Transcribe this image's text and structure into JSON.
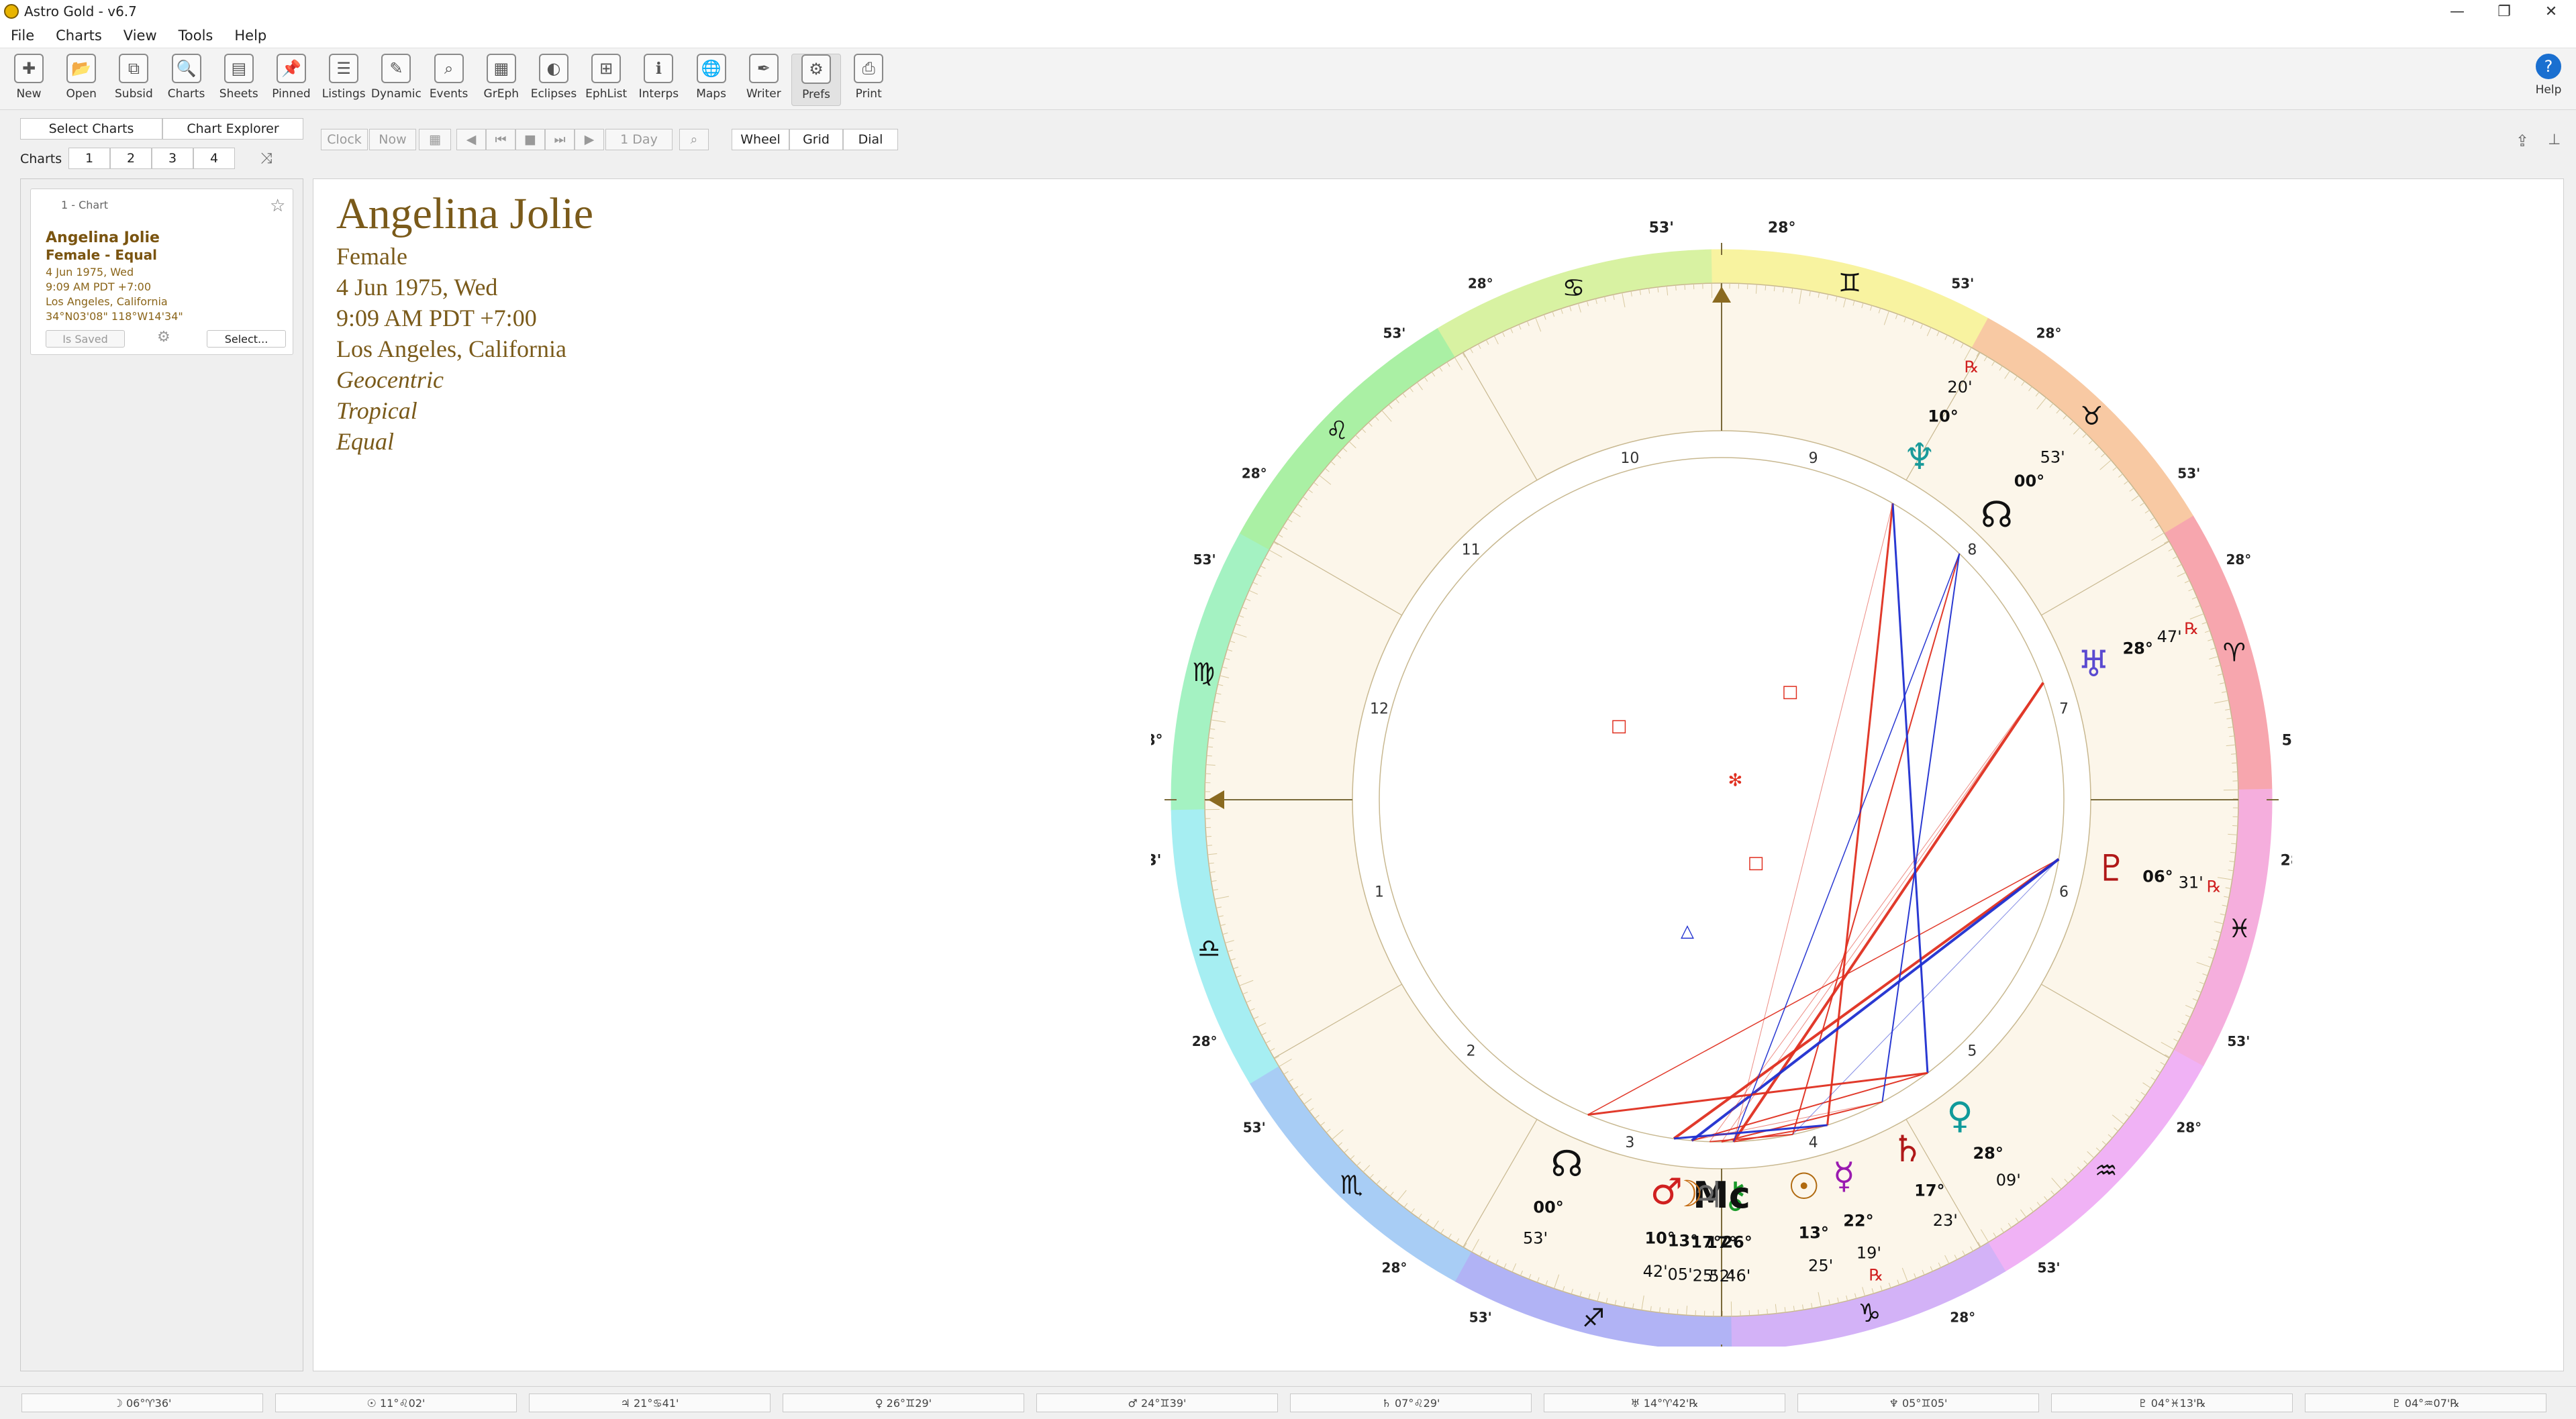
{
  "window": {
    "title": "Astro Gold - v6.7"
  },
  "menu": [
    "File",
    "Charts",
    "View",
    "Tools",
    "Help"
  ],
  "toolbar": [
    {
      "label": "New",
      "icon": "new-chart-icon"
    },
    {
      "label": "Open",
      "icon": "open-icon"
    },
    {
      "label": "Subsid",
      "icon": "subsid-icon"
    },
    {
      "label": "Charts",
      "icon": "charts-icon"
    },
    {
      "label": "Sheets",
      "icon": "sheets-icon"
    },
    {
      "label": "Pinned",
      "icon": "pin-icon"
    },
    {
      "label": "Listings",
      "icon": "listings-icon"
    },
    {
      "label": "Dynamic",
      "icon": "dynamic-icon"
    },
    {
      "label": "Events",
      "icon": "events-icon"
    },
    {
      "label": "GrEph",
      "icon": "graphic-ephemeris-icon"
    },
    {
      "label": "Eclipses",
      "icon": "eclipses-icon"
    },
    {
      "label": "EphList",
      "icon": "ephemeris-list-icon"
    },
    {
      "label": "Interps",
      "icon": "interpretations-icon"
    },
    {
      "label": "Maps",
      "icon": "globe-icon"
    },
    {
      "label": "Writer",
      "icon": "quill-icon"
    },
    {
      "label": "Prefs",
      "icon": "gear-icon"
    },
    {
      "label": "Print",
      "icon": "printer-icon"
    }
  ],
  "help_label": "Help",
  "left_tabs": [
    "Select Charts",
    "Chart Explorer"
  ],
  "charts_label": "Charts",
  "chart_slots": [
    "1",
    "2",
    "3",
    "4"
  ],
  "time_controls": {
    "clock": "Clock",
    "now": "Now",
    "step": "1 Day"
  },
  "view_tabs": [
    "Wheel",
    "Grid",
    "Dial"
  ],
  "chart_card": {
    "header": "1 - Chart",
    "name": "Angelina Jolie",
    "subtitle": "Female - Equal",
    "date": "4 Jun 1975, Wed",
    "time": "9:09 AM PDT +7:00",
    "place": "Los Angeles, California",
    "coords": "34°N03'08\" 118°W14'34\"",
    "saved_label": "Is Saved",
    "select_label": "Select..."
  },
  "chart_info": {
    "name": "Angelina Jolie",
    "gender": "Female",
    "date": "4 Jun 1975, Wed",
    "time": "9:09 AM PDT +7:00",
    "place": "Los Angeles, California",
    "zodiac_view": "Geocentric",
    "zodiac": "Tropical",
    "house_system": "Equal"
  },
  "wheel": {
    "asc_degree": "28°",
    "asc_minute": "53'",
    "house_numbers": [
      "1",
      "2",
      "3",
      "4",
      "5",
      "6",
      "7",
      "8",
      "9",
      "10",
      "11",
      "12"
    ],
    "sign_glyphs": [
      "♈",
      "♉",
      "♊",
      "♋",
      "♌",
      "♍",
      "♎",
      "♏",
      "♐",
      "♑",
      "♒",
      "♓"
    ],
    "colors": {
      "aries": "#f7a6ae",
      "taurus": "#f8c9a3",
      "gemini": "#f8f3a0",
      "cancer": "#d8f2a2",
      "leo": "#aaf0a4",
      "virgo": "#a4f2c2",
      "libra": "#a6eef2",
      "scorpio": "#a8cdf5",
      "sagittarius": "#b1b3f5",
      "capricorn": "#d3b2f7",
      "aquarius": "#f0b2f5",
      "pisces": "#f5aedd",
      "inner": "#fcf6ea",
      "hard_aspect": "#e03020",
      "soft_aspect": "#1f2fd0",
      "text": "#7a5a1a"
    },
    "planets": [
      {
        "glyph": "⚷",
        "name": "Chiron",
        "deg": "26°",
        "min": "46'",
        "color": "#1a9a2a"
      },
      {
        "glyph": "Mc",
        "name": "Midheaven",
        "deg": "17°",
        "min": "52'",
        "color": "#111111"
      },
      {
        "glyph": "♃",
        "name": "Jupiter",
        "deg": "17°",
        "min": "25'",
        "color": "#666666"
      },
      {
        "glyph": "☽",
        "name": "Moon",
        "deg": "13°",
        "min": "05'",
        "color": "#c46a10"
      },
      {
        "glyph": "♂",
        "name": "Mars",
        "deg": "10°",
        "min": "42'",
        "color": "#d02020"
      },
      {
        "glyph": "☊",
        "name": "South Node",
        "deg": "00°",
        "min": "53'",
        "color": "#111111"
      },
      {
        "glyph": "☉",
        "name": "Sun",
        "deg": "13°",
        "min": "25'",
        "color": "#b06a10"
      },
      {
        "glyph": "☿",
        "name": "Mercury",
        "deg": "22°",
        "min": "19'",
        "retro": "℞",
        "color": "#9a1ab0"
      },
      {
        "glyph": "♄",
        "name": "Saturn",
        "deg": "17°",
        "min": "23'",
        "color": "#b01818"
      },
      {
        "glyph": "♀",
        "name": "Venus",
        "deg": "28°",
        "min": "09'",
        "color": "#109a9a"
      },
      {
        "glyph": "♇",
        "name": "Pluto",
        "deg": "06°",
        "min": "31'",
        "retro": "℞",
        "color": "#b01818"
      },
      {
        "glyph": "♅",
        "name": "Uranus",
        "deg": "28°",
        "min": "47'",
        "retro": "℞",
        "color": "#5a4ad0"
      },
      {
        "glyph": "☊",
        "name": "North Node",
        "deg": "00°",
        "min": "53'",
        "color": "#111111"
      },
      {
        "glyph": "♆",
        "name": "Neptune",
        "deg": "10°",
        "min": "20'",
        "retro": "℞",
        "color": "#1a9a9a"
      }
    ]
  },
  "status": [
    "☽ 06°♈36'",
    "☉ 11°♌02'",
    "♃ 21°♋41'",
    "♀ 26°♊29'",
    "♂ 24°♊39'",
    "♄ 07°♌29'",
    "♅ 14°♈42'℞",
    "♆ 05°♊05'",
    "♇ 04°♓13'℞",
    "♇ 04°♒07'℞"
  ]
}
